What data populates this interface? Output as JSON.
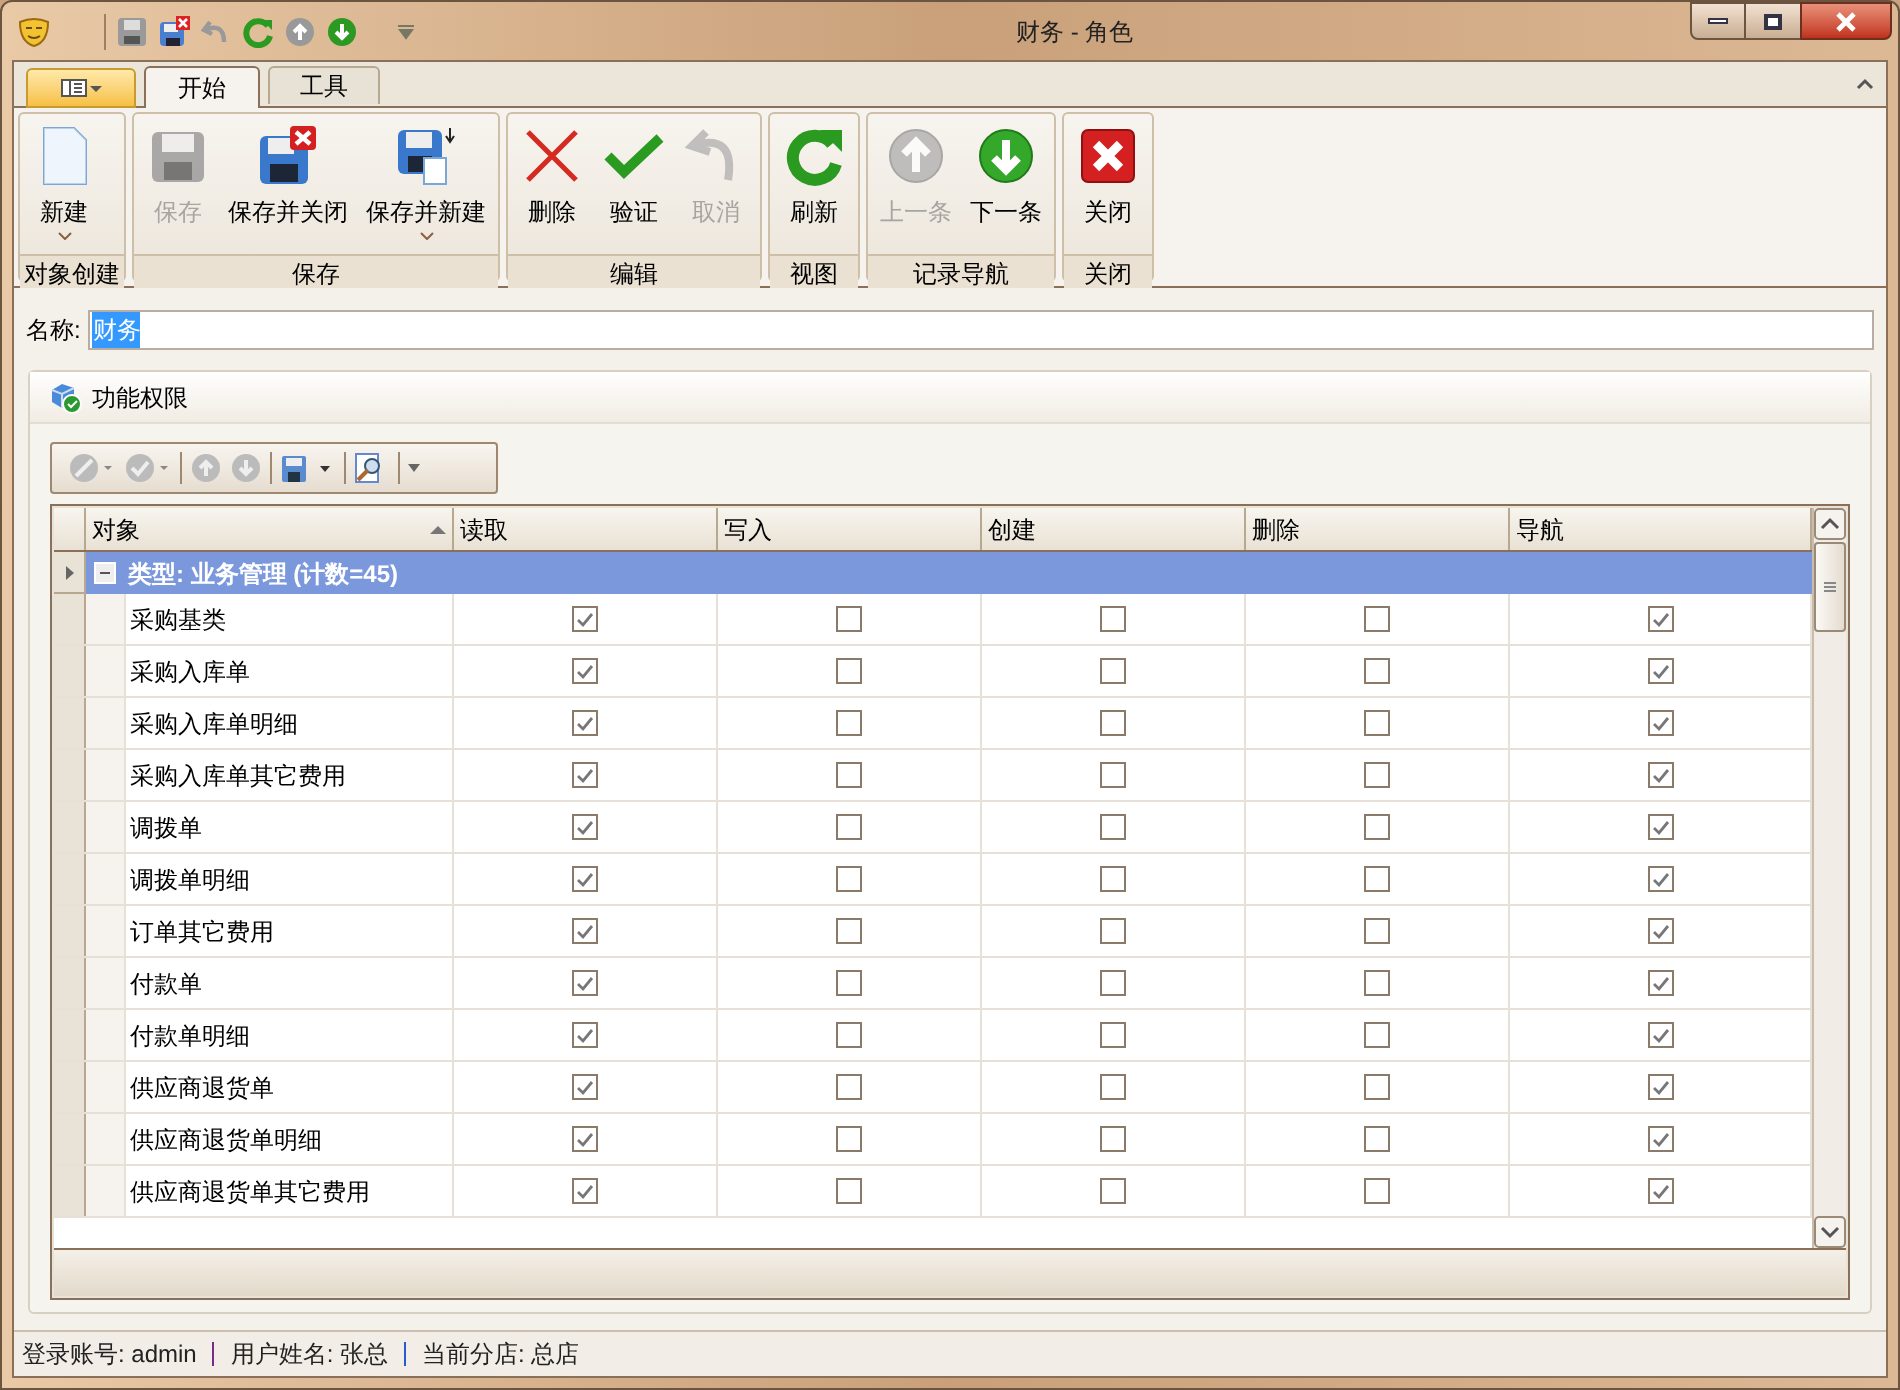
{
  "window": {
    "title": "财务 - 角色"
  },
  "tabs": [
    {
      "label": "开始",
      "selected": true
    },
    {
      "label": "工具",
      "selected": false
    }
  ],
  "ribbon_groups": [
    {
      "label": "对象创建",
      "buttons": [
        {
          "label": "新建",
          "disabled": false,
          "dropdown": true
        }
      ]
    },
    {
      "label": "保存",
      "buttons": [
        {
          "label": "保存",
          "disabled": true,
          "dropdown": false
        },
        {
          "label": "保存并关闭",
          "disabled": false,
          "dropdown": false
        },
        {
          "label": "保存并新建",
          "disabled": false,
          "dropdown": true
        }
      ]
    },
    {
      "label": "编辑",
      "buttons": [
        {
          "label": "删除",
          "disabled": false,
          "dropdown": false
        },
        {
          "label": "验证",
          "disabled": false,
          "dropdown": false
        },
        {
          "label": "取消",
          "disabled": true,
          "dropdown": false
        }
      ]
    },
    {
      "label": "视图",
      "buttons": [
        {
          "label": "刷新",
          "disabled": false,
          "dropdown": false
        }
      ]
    },
    {
      "label": "记录导航",
      "buttons": [
        {
          "label": "上一条",
          "disabled": true,
          "dropdown": false
        },
        {
          "label": "下一条",
          "disabled": false,
          "dropdown": false
        }
      ]
    },
    {
      "label": "关闭",
      "buttons": [
        {
          "label": "关闭",
          "disabled": false,
          "dropdown": false
        }
      ]
    }
  ],
  "name_field": {
    "label": "名称:",
    "value": "财务",
    "text_selected": true
  },
  "panel": {
    "title": "功能权限"
  },
  "table": {
    "columns": [
      {
        "label": "对象",
        "sorted": true
      },
      {
        "label": "读取",
        "sorted": false
      },
      {
        "label": "写入",
        "sorted": false
      },
      {
        "label": "创建",
        "sorted": false
      },
      {
        "label": "删除",
        "sorted": false
      },
      {
        "label": "导航",
        "sorted": false
      }
    ],
    "group": {
      "label": "类型: 业务管理 (计数=45)",
      "expanded": true,
      "current": true
    },
    "rows": [
      {
        "name": "采购基类",
        "read": true,
        "write": false,
        "create": false,
        "delete": false,
        "navigate": true
      },
      {
        "name": "采购入库单",
        "read": true,
        "write": false,
        "create": false,
        "delete": false,
        "navigate": true
      },
      {
        "name": "采购入库单明细",
        "read": true,
        "write": false,
        "create": false,
        "delete": false,
        "navigate": true
      },
      {
        "name": "采购入库单其它费用",
        "read": true,
        "write": false,
        "create": false,
        "delete": false,
        "navigate": true
      },
      {
        "name": "调拨单",
        "read": true,
        "write": false,
        "create": false,
        "delete": false,
        "navigate": true
      },
      {
        "name": "调拨单明细",
        "read": true,
        "write": false,
        "create": false,
        "delete": false,
        "navigate": true
      },
      {
        "name": "订单其它费用",
        "read": true,
        "write": false,
        "create": false,
        "delete": false,
        "navigate": true
      },
      {
        "name": "付款单",
        "read": true,
        "write": false,
        "create": false,
        "delete": false,
        "navigate": true
      },
      {
        "name": "付款单明细",
        "read": true,
        "write": false,
        "create": false,
        "delete": false,
        "navigate": true
      },
      {
        "name": "供应商退货单",
        "read": true,
        "write": false,
        "create": false,
        "delete": false,
        "navigate": true
      },
      {
        "name": "供应商退货单明细",
        "read": true,
        "write": false,
        "create": false,
        "delete": false,
        "navigate": true
      },
      {
        "name": "供应商退货单其它费用",
        "read": true,
        "write": false,
        "create": false,
        "delete": false,
        "navigate": true
      }
    ]
  },
  "status_bar": [
    "登录账号: admin",
    "用户姓名: 张总",
    "当前分店: 总店"
  ]
}
